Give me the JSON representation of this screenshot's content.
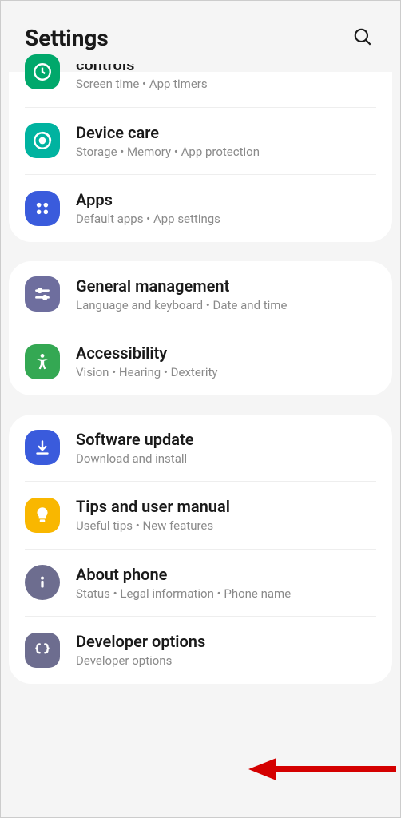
{
  "header": {
    "title": "Settings"
  },
  "groups": [
    {
      "items": [
        {
          "key": "digital_wellbeing",
          "title": "controls",
          "subtitle": "Screen time  •  App timers",
          "partial": true
        },
        {
          "key": "device_care",
          "title": "Device care",
          "subtitle": "Storage  •  Memory  •  App protection"
        },
        {
          "key": "apps",
          "title": "Apps",
          "subtitle": "Default apps  •  App settings"
        }
      ]
    },
    {
      "items": [
        {
          "key": "general_management",
          "title": "General management",
          "subtitle": "Language and keyboard  •  Date and time"
        },
        {
          "key": "accessibility",
          "title": "Accessibility",
          "subtitle": "Vision  •  Hearing  •  Dexterity"
        }
      ]
    },
    {
      "items": [
        {
          "key": "software_update",
          "title": "Software update",
          "subtitle": "Download and install"
        },
        {
          "key": "tips",
          "title": "Tips and user manual",
          "subtitle": "Useful tips  •  New features"
        },
        {
          "key": "about_phone",
          "title": "About phone",
          "subtitle": "Status  •  Legal information  •  Phone name"
        },
        {
          "key": "developer_options",
          "title": "Developer options",
          "subtitle": "Developer options"
        }
      ]
    }
  ]
}
